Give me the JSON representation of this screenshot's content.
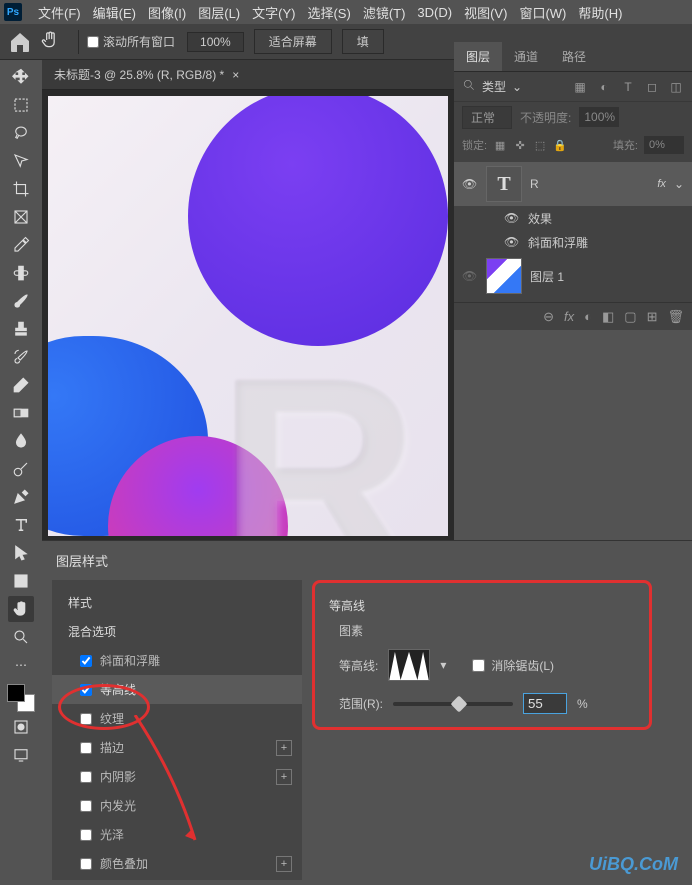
{
  "app": {
    "icon_label": "Ps"
  },
  "menu": [
    "文件(F)",
    "编辑(E)",
    "图像(I)",
    "图层(L)",
    "文字(Y)",
    "选择(S)",
    "滤镜(T)",
    "3D(D)",
    "视图(V)",
    "窗口(W)",
    "帮助(H)"
  ],
  "toolbar": {
    "scroll_all": "滚动所有窗口",
    "zoom": "100%",
    "fit": "适合屏幕",
    "fill": "填"
  },
  "document": {
    "tab_title": "未标题-3 @ 25.8% (R, RGB/8) *"
  },
  "panels": {
    "tabs": [
      "图层",
      "通道",
      "路径"
    ],
    "search_label": "类型",
    "blend_mode": "正常",
    "opacity_label": "不透明度:",
    "opacity_value": "100%",
    "lock_label": "锁定:",
    "fill_label": "填充:",
    "fill_value": "0%",
    "layers": [
      {
        "name": "R",
        "type": "text",
        "fx": "fx",
        "selected": true
      },
      {
        "name": "效果",
        "type": "sub"
      },
      {
        "name": "斜面和浮雕",
        "type": "sub"
      },
      {
        "name": "图层 1",
        "type": "raster"
      }
    ],
    "footer_icons": [
      "⊖",
      "fx",
      "◐",
      "◧",
      "▢",
      "⊞",
      "🗑"
    ]
  },
  "dialog": {
    "title": "图层样式",
    "list_header": "样式",
    "blend_options": "混合选项",
    "items": [
      {
        "label": "斜面和浮雕",
        "checked": true,
        "plus": false
      },
      {
        "label": "等高线",
        "checked": true,
        "plus": false,
        "active": true
      },
      {
        "label": "纹理",
        "checked": false,
        "plus": false
      },
      {
        "label": "描边",
        "checked": false,
        "plus": true
      },
      {
        "label": "内阴影",
        "checked": false,
        "plus": true
      },
      {
        "label": "内发光",
        "checked": false,
        "plus": false
      },
      {
        "label": "光泽",
        "checked": false,
        "plus": false
      },
      {
        "label": "颜色叠加",
        "checked": false,
        "plus": true
      }
    ],
    "section_title": "等高线",
    "section_sub": "图素",
    "contour_label": "等高线:",
    "antialias_label": "消除锯齿(L)",
    "range_label": "范围(R):",
    "range_value": "55",
    "range_unit": "%"
  },
  "watermark": "UiBQ.CoM"
}
